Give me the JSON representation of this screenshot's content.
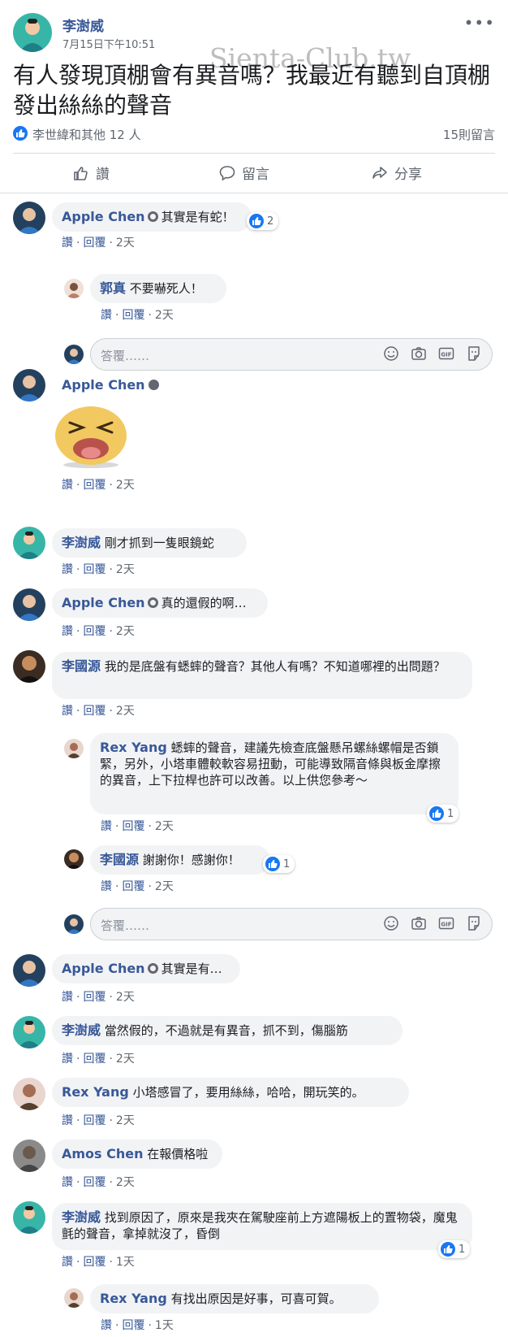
{
  "post": {
    "author": "李澍威",
    "time": "7月15日下午10:51",
    "watermark": "Sienta-Club.tw",
    "text": "有人發現頂棚會有異音嗎？我最近有聽到自頂棚發出絲絲的聲音",
    "reactions_text": "李世緯和其他 12 人",
    "comments_count": "15則留言"
  },
  "actions": {
    "like": "讚",
    "comment": "留言",
    "share": "分享"
  },
  "labels": {
    "like": "讚",
    "reply": "回覆",
    "separator": "·",
    "reply_placeholder": "答覆……"
  },
  "colors": {
    "link": "#385898",
    "like_blue": "#1877f2",
    "bubble_bg": "#f2f3f5"
  },
  "comments": [
    {
      "name": "Apple Chen",
      "text": "其實是有蛇！",
      "time": "2天",
      "reactions": "2"
    },
    {
      "name": "郭真",
      "text": "不要嚇死人！",
      "time": "2天"
    },
    {
      "name": "Apple Chen",
      "text": "",
      "time": "2天",
      "sticker": "laughing-sticker"
    },
    {
      "name": "李澍威",
      "text": "剛才抓到一隻眼鏡蛇",
      "time": "2天"
    },
    {
      "name": "Apple Chen",
      "text": "真的還假的啊…",
      "time": "2天"
    },
    {
      "name": "李國源",
      "text": "我的是底盤有蟋蟀的聲音？其他人有嗎？不知道哪裡的出問題？",
      "time": "2天"
    },
    {
      "name": "Rex Yang",
      "text": "蟋蟀的聲音，建議先檢查底盤懸吊螺絲螺帽是否鎖緊，另外，小塔車體較軟容易扭動，可能導致隔音條與板金摩擦的異音，上下拉桿也許可以改善。以上供您參考～",
      "time": "2天",
      "reactions": "1"
    },
    {
      "name": "李國源",
      "text": "謝謝你！感謝你！",
      "time": "2天",
      "reactions": "1"
    },
    {
      "name": "Apple Chen",
      "text": "其實是有…",
      "time": "2天"
    },
    {
      "name": "李澍威",
      "text": "當然假的，不過就是有異音，抓不到，傷腦筋",
      "time": "2天"
    },
    {
      "name": "Rex Yang",
      "text": "小塔感冒了，要用絲絲，哈哈，開玩笑的。",
      "time": "2天"
    },
    {
      "name": "Amos Chen",
      "text": "在報價格啦",
      "time": "2天"
    },
    {
      "name": "李澍威",
      "text": "找到原因了，原來是我夾在駕駛座前上方遮陽板上的置物袋，魔鬼氈的聲音，拿掉就沒了，昏倒",
      "time": "1天",
      "reactions": "1"
    },
    {
      "name": "Rex Yang",
      "text": "有找出原因是好事，可喜可賀。",
      "time": "1天"
    }
  ]
}
